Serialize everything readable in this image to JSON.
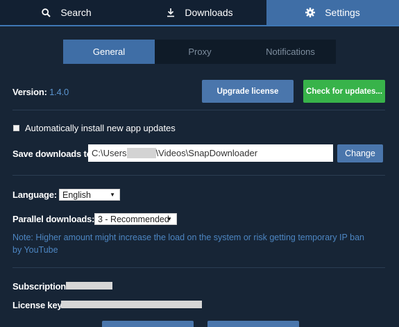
{
  "nav": {
    "tabs": [
      {
        "label": "Search",
        "icon": "search-icon"
      },
      {
        "label": "Downloads",
        "icon": "download-icon"
      },
      {
        "label": "Settings",
        "icon": "gear-icon"
      }
    ],
    "active_tab": "Settings"
  },
  "subtabs": {
    "items": [
      "General",
      "Proxy",
      "Notifications"
    ],
    "active": "General"
  },
  "version": {
    "label": "Version:",
    "value": "1.4.0"
  },
  "buttons": {
    "upgrade": "Upgrade license",
    "check_updates": "Check for updates...",
    "change": "Change"
  },
  "auto_update": {
    "label": "Automatically install new app updates",
    "checked": false
  },
  "save_downloads": {
    "label": "Save downloads to:",
    "path_prefix": "C:\\Users",
    "path_suffix": "\\Videos\\SnapDownloader"
  },
  "language": {
    "label": "Language:",
    "value": "English"
  },
  "parallel": {
    "label": "Parallel downloads:",
    "value": "3 - Recommended"
  },
  "note": "Note: Higher amount might increase the load on the system or risk getting temporary IP ban by YouTube",
  "subscription": {
    "label": "Subscription:"
  },
  "license": {
    "label": "License key:"
  },
  "colors": {
    "background": "#172536",
    "accent_blue": "#3f6ea6",
    "button_green": "#38b34a",
    "link_blue": "#4d86c2"
  }
}
